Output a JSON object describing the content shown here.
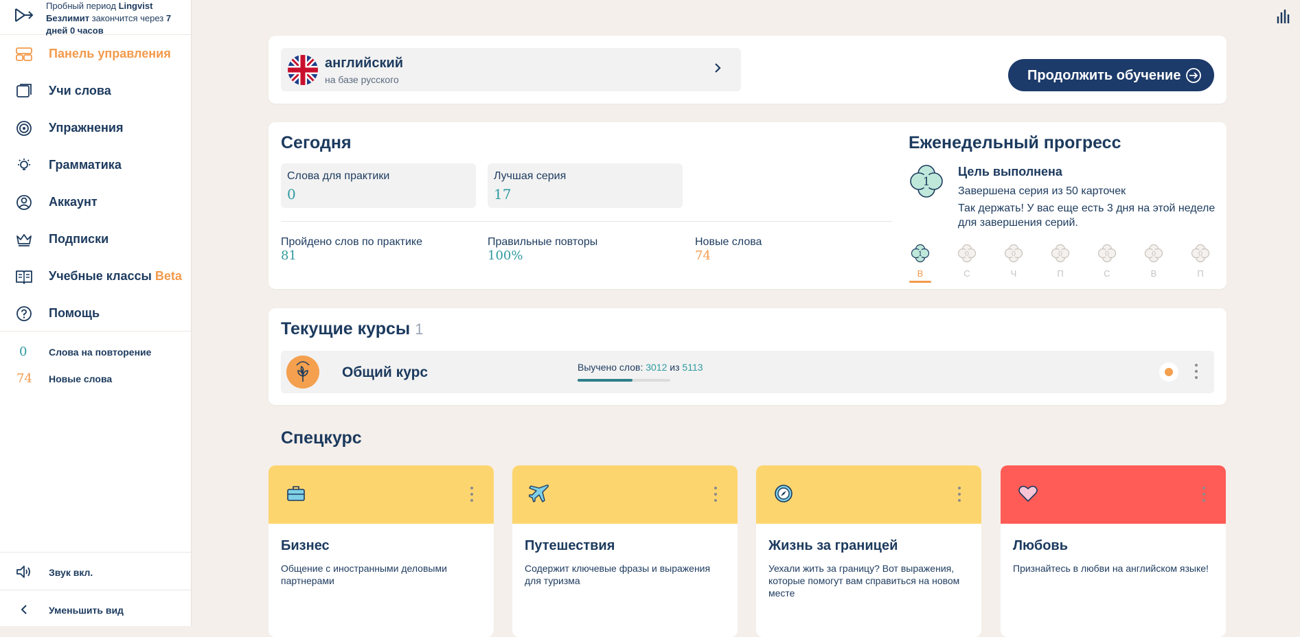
{
  "sidebar": {
    "trial": {
      "line1_prefix": "Пробный период ",
      "line1_brand": "Lingvist",
      "line2_plan": "Безлимит",
      "line2_mid": " закончится через ",
      "line2_num": "7",
      "line3": "дней 0 часов"
    },
    "nav": [
      {
        "label": "Панель управления",
        "icon": "dashboard-icon"
      },
      {
        "label": "Учи слова",
        "icon": "cards-icon"
      },
      {
        "label": "Упражнения",
        "icon": "exercises-icon"
      },
      {
        "label": "Грамматика",
        "icon": "bulb-icon"
      },
      {
        "label": "Аккаунт",
        "icon": "account-icon"
      },
      {
        "label": "Подписки",
        "icon": "crown-icon"
      },
      {
        "label": "Учебные классы",
        "badge": "Beta",
        "icon": "book-icon"
      },
      {
        "label": "Помощь",
        "icon": "help-icon"
      }
    ],
    "stats": [
      {
        "value": "0",
        "label": "Слова на повторение"
      },
      {
        "value": "74",
        "label": "Новые слова"
      }
    ],
    "sound_label": "Звук вкл.",
    "collapse_label": "Уменьшить вид"
  },
  "language": {
    "name": "английский",
    "base": "на базе русского"
  },
  "continue_button": "Продолжить обучение",
  "today": {
    "title": "Сегодня",
    "tiles": [
      {
        "label": "Слова для практики",
        "value": "0"
      },
      {
        "label": "Лучшая серия",
        "value": "17"
      }
    ],
    "stats": [
      {
        "label": "Пройдено слов по практике",
        "value": "81",
        "color": "#2f9aa0"
      },
      {
        "label": "Правильные повторы",
        "value": "100%",
        "color": "#2f9aa0"
      },
      {
        "label": "Новые слова",
        "value": "74",
        "color": "#f39a4c"
      }
    ]
  },
  "weekly": {
    "title": "Еженедельный прогресс",
    "badge_number": "1",
    "goal_title": "Цель выполнена",
    "goal_sub": "Завершена серия из 50 карточек",
    "goal_text": "Так держать! У вас еще есть 3 дня на этой неделе для завершения серий.",
    "days": [
      {
        "label": "В",
        "value": "1",
        "done": true
      },
      {
        "label": "С",
        "value": "0",
        "done": false
      },
      {
        "label": "Ч",
        "value": "0",
        "done": false
      },
      {
        "label": "П",
        "value": "0",
        "done": false
      },
      {
        "label": "С",
        "value": "0",
        "done": false
      },
      {
        "label": "В",
        "value": "0",
        "done": false
      },
      {
        "label": "П",
        "value": "0",
        "done": false
      }
    ]
  },
  "current_courses": {
    "title": "Текущие курсы",
    "count": "1",
    "course": {
      "name": "Общий курс",
      "learned_label": "Выучено слов: ",
      "learned": "3012",
      "of": " из ",
      "total": "5113",
      "progress_fraction": 0.589
    }
  },
  "special": {
    "title": "Спецкурс",
    "items": [
      {
        "title": "Бизнес",
        "desc": "Общение с иностранными деловыми партнерами",
        "color": "#fdd56f",
        "icon": "briefcase-icon"
      },
      {
        "title": "Путешествия",
        "desc": "Содержит ключевые фразы и выражения для туризма",
        "color": "#fdd56f",
        "icon": "airplane-icon"
      },
      {
        "title": "Жизнь за границей",
        "desc": "Уехали жить за границу? Вот выражения, которые помогут вам справиться на новом месте",
        "color": "#fdd56f",
        "icon": "compass-icon"
      },
      {
        "title": "Любовь",
        "desc": "Признайтесь в любви на английском языке!",
        "color": "#ff5c57",
        "icon": "heart-icon"
      }
    ]
  },
  "colors": {
    "accent": "#f39a4c",
    "navy": "#1c3a6a",
    "teal": "#2f9aa0",
    "background": "#f4efea"
  }
}
